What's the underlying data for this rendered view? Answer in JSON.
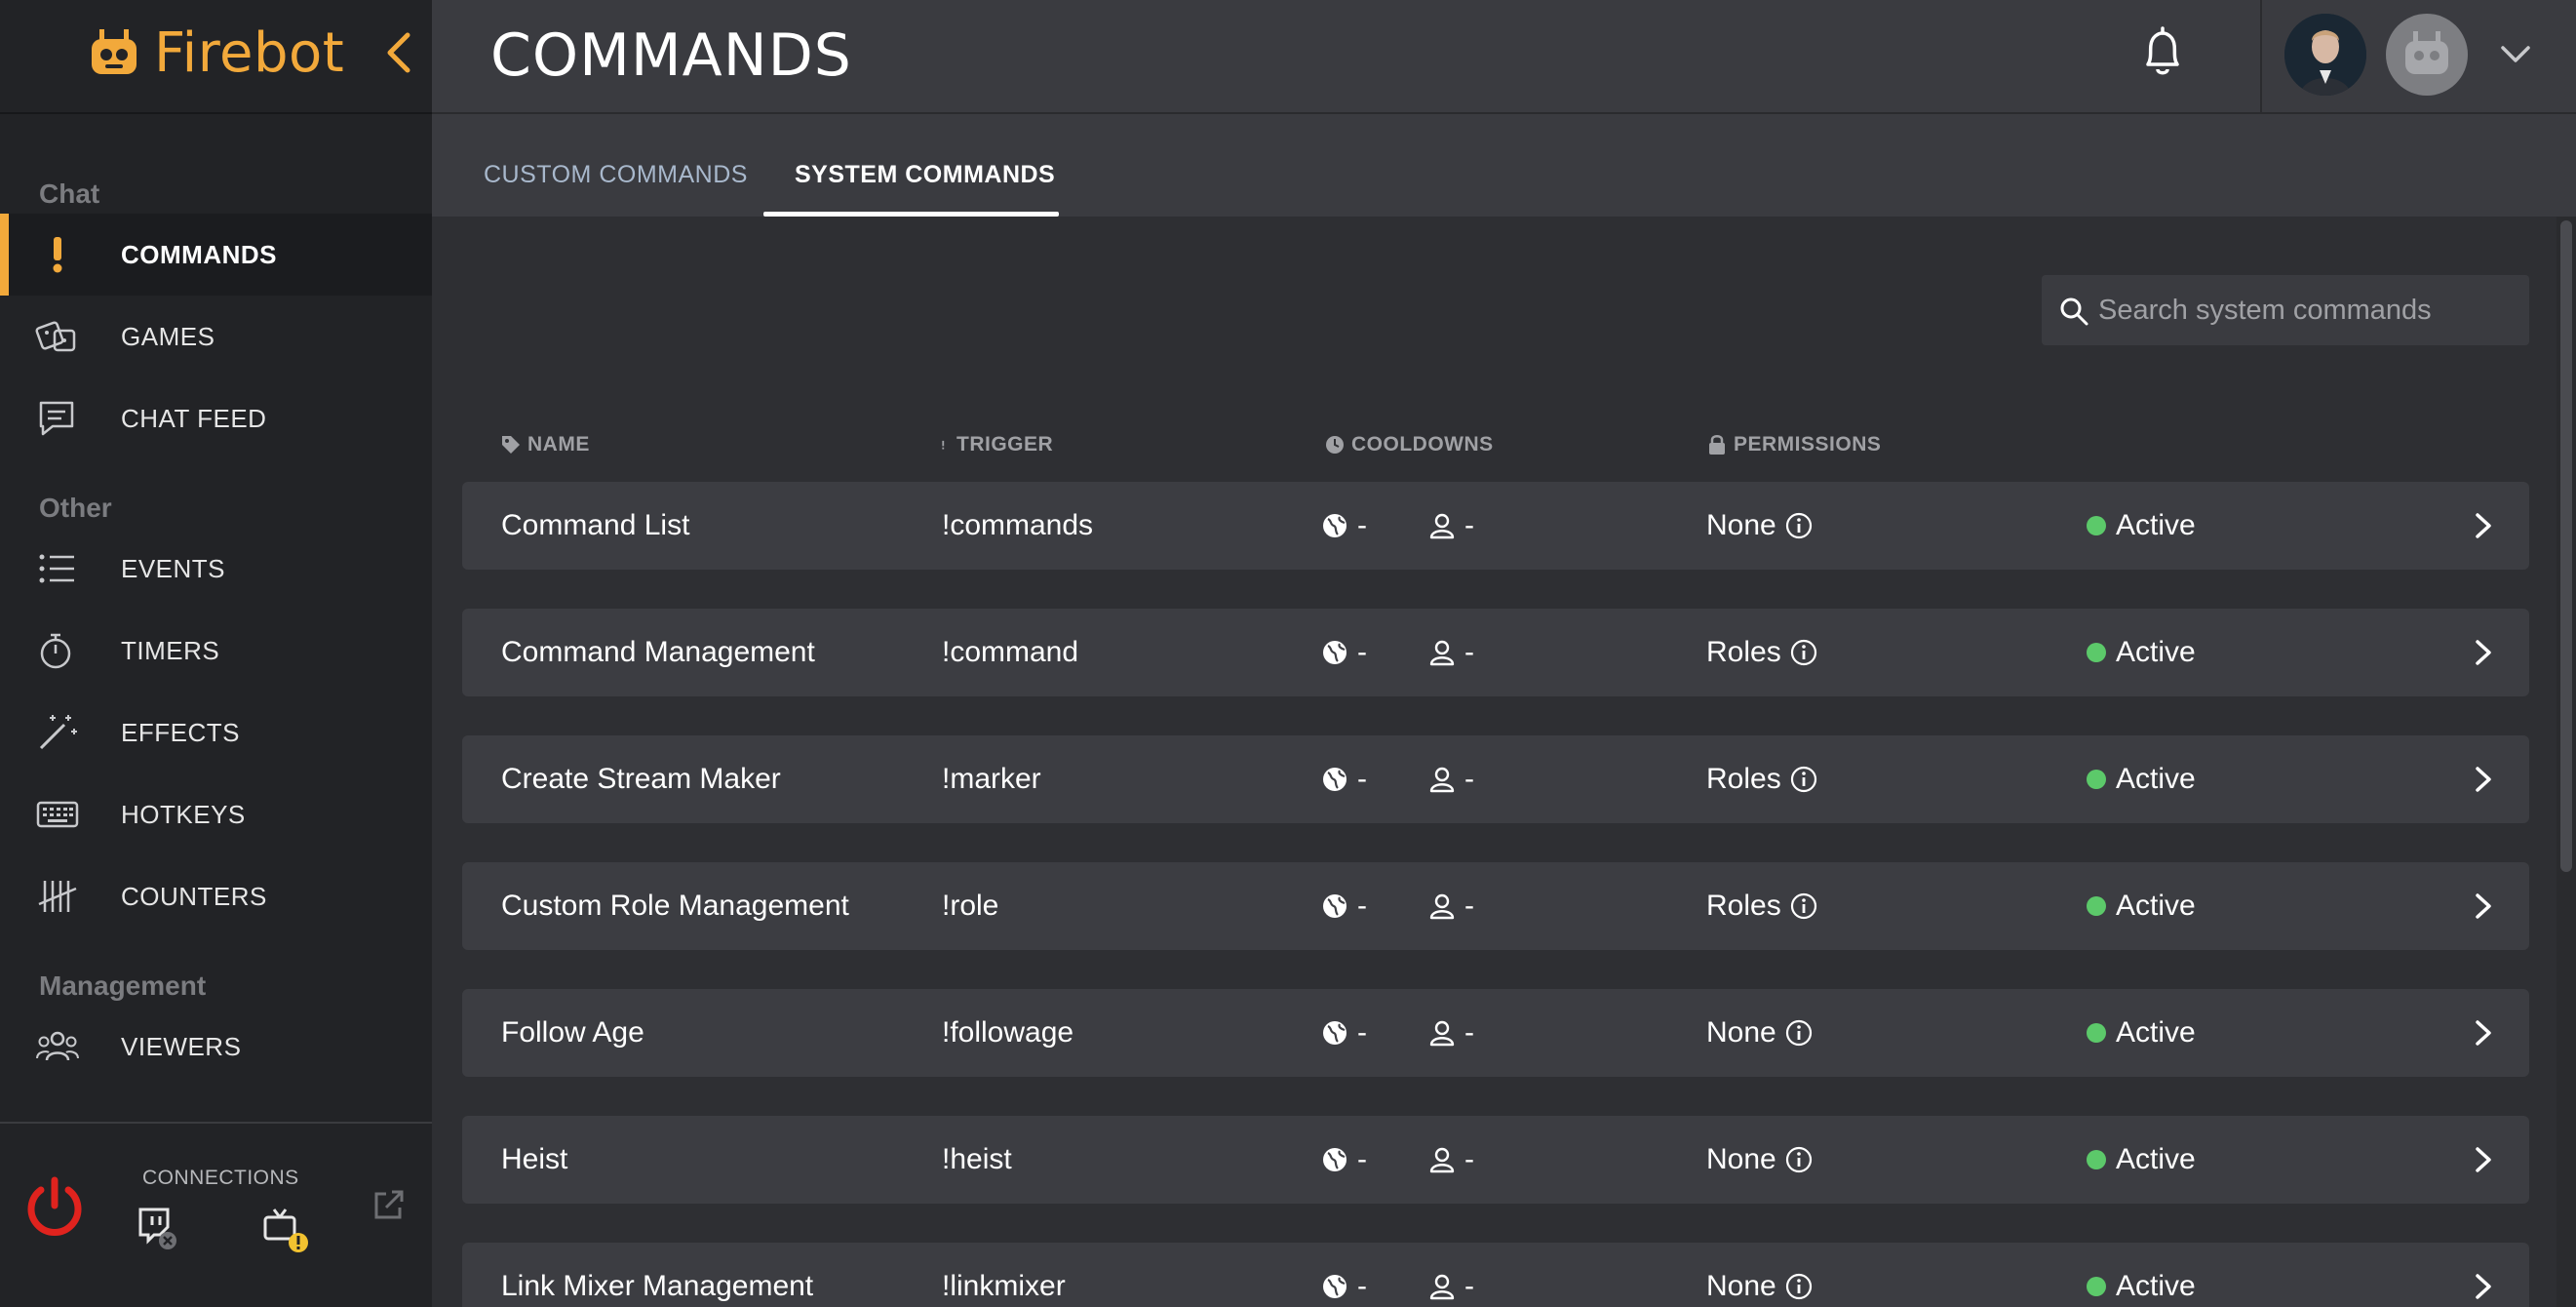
{
  "app": {
    "name": "Firebot",
    "colors": {
      "accent": "#f2a93b",
      "sidebar_bg": "#222326",
      "header_bg": "#3a3b40",
      "main_bg": "#2e2f33",
      "row_bg": "#3c3d42",
      "status_active": "#5cc96a",
      "power_red": "#e0231e"
    }
  },
  "header": {
    "title": "COMMANDS"
  },
  "sidebar": {
    "sections": {
      "chat": "Chat",
      "other": "Other",
      "management": "Management"
    },
    "items": [
      {
        "label": "COMMANDS",
        "icon": "exclamation-icon",
        "active": true
      },
      {
        "label": "GAMES",
        "icon": "dice-icon"
      },
      {
        "label": "CHAT FEED",
        "icon": "chat-icon"
      },
      {
        "label": "EVENTS",
        "icon": "list-icon"
      },
      {
        "label": "TIMERS",
        "icon": "stopwatch-icon"
      },
      {
        "label": "EFFECTS",
        "icon": "magic-wand-icon"
      },
      {
        "label": "HOTKEYS",
        "icon": "keyboard-icon"
      },
      {
        "label": "COUNTERS",
        "icon": "tally-icon"
      },
      {
        "label": "VIEWERS",
        "icon": "users-icon"
      }
    ],
    "connections_label": "CONNECTIONS"
  },
  "tabs": [
    {
      "label": "CUSTOM COMMANDS",
      "active": false
    },
    {
      "label": "SYSTEM COMMANDS",
      "active": true
    }
  ],
  "search": {
    "placeholder": "Search system commands",
    "value": ""
  },
  "table": {
    "headers": {
      "name": "NAME",
      "trigger": "TRIGGER",
      "cooldowns": "COOLDOWNS",
      "permissions": "PERMISSIONS"
    },
    "rows": [
      {
        "name": "Command List",
        "trigger": "!commands",
        "global_cd": "-",
        "user_cd": "-",
        "permissions": "None",
        "status": "Active"
      },
      {
        "name": "Command Management",
        "trigger": "!command",
        "global_cd": "-",
        "user_cd": "-",
        "permissions": "Roles",
        "status": "Active"
      },
      {
        "name": "Create Stream Maker",
        "trigger": "!marker",
        "global_cd": "-",
        "user_cd": "-",
        "permissions": "Roles",
        "status": "Active"
      },
      {
        "name": "Custom Role Management",
        "trigger": "!role",
        "global_cd": "-",
        "user_cd": "-",
        "permissions": "Roles",
        "status": "Active"
      },
      {
        "name": "Follow Age",
        "trigger": "!followage",
        "global_cd": "-",
        "user_cd": "-",
        "permissions": "None",
        "status": "Active"
      },
      {
        "name": "Heist",
        "trigger": "!heist",
        "global_cd": "-",
        "user_cd": "-",
        "permissions": "None",
        "status": "Active"
      },
      {
        "name": "Link Mixer Management",
        "trigger": "!linkmixer",
        "global_cd": "-",
        "user_cd": "-",
        "permissions": "None",
        "status": "Active"
      }
    ]
  }
}
